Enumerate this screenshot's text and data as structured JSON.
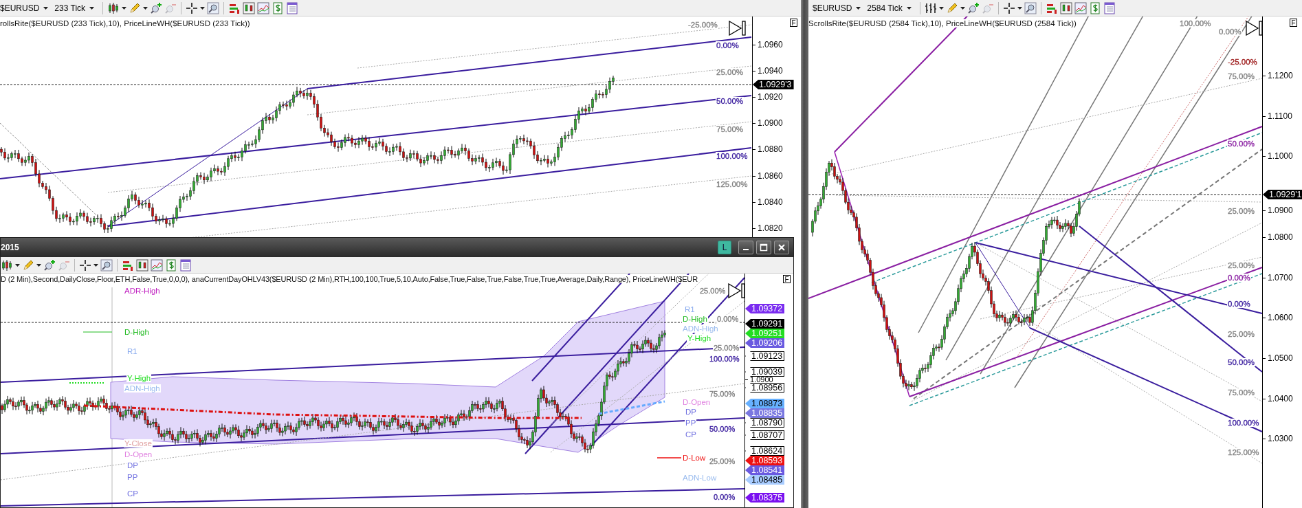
{
  "top_left_chart": {
    "instrument": "$EURUSD",
    "interval": "233 Tick",
    "tools": [
      {
        "disabled": false
      },
      {
        "disabled": false
      },
      {
        "disabled": false
      },
      {
        "disabled": true
      },
      {
        "disabled": false
      },
      {
        "disabled": false
      },
      {
        "disabled": false
      },
      {
        "disabled": false
      },
      {
        "disabled": false
      },
      {
        "disabled": false
      },
      {
        "disabled": false
      }
    ],
    "indicators": "rollsRite($EURUSD (233 Tick),10), PriceLineWH($EURUSD (233 Tick))",
    "panel_button": "F",
    "price_ticks": [
      "1.0960",
      "1.0940",
      "1.0920",
      "1.0900",
      "1.0880",
      "1.0860",
      "1.0840",
      "1.0820"
    ],
    "current_price": "1.0929'3",
    "fib_labels": [
      {
        "text": "-25.00%",
        "color": "#808080"
      },
      {
        "text": "0.00%",
        "color": "#3a1d9e"
      },
      {
        "text": "25.00%",
        "color": "#808080"
      },
      {
        "text": "50.00%",
        "color": "#3a1d9e"
      },
      {
        "text": "75.00%",
        "color": "#808080"
      },
      {
        "text": "100.00%",
        "color": "#3a1d9e"
      },
      {
        "text": "125.00%",
        "color": "#808080"
      }
    ]
  },
  "right_chart": {
    "instrument": "$EURUSD",
    "interval": "2584 Tick",
    "tools": [
      {
        "disabled": false
      },
      {
        "disabled": false
      },
      {
        "disabled": false
      },
      {
        "disabled": true
      },
      {
        "disabled": false
      },
      {
        "disabled": false
      },
      {
        "disabled": false
      },
      {
        "disabled": false
      },
      {
        "disabled": false
      },
      {
        "disabled": false
      },
      {
        "disabled": false
      }
    ],
    "indicators": "ScrollsRite($EURUSD (2584 Tick),10), PriceLineWH($EURUSD (2584 Tick))",
    "panel_button": "F",
    "price_ticks": [
      "1.1200",
      "1.1100",
      "1.1000",
      "1.0900",
      "1.0800",
      "1.0700",
      "1.0600",
      "1.0500",
      "1.0400",
      "1.0300"
    ],
    "current_price": "1.0929'1",
    "fib_labels": [
      {
        "text": "100.00%",
        "color": "#808080"
      },
      {
        "text": "0.00%",
        "color": "#808080"
      },
      {
        "text": "-25.00%",
        "color": "#a02020"
      },
      {
        "text": "75.00%",
        "color": "#808080"
      },
      {
        "text": "50.00%",
        "color": "#8a1fa2"
      },
      {
        "text": "25.00%",
        "color": "#808080"
      },
      {
        "text": "25.00%",
        "color": "#808080"
      },
      {
        "text": "0.00%",
        "color": "#8a1fa2"
      },
      {
        "text": "0.00%",
        "color": "#3a1d9e"
      },
      {
        "text": "25.00%",
        "color": "#808080"
      },
      {
        "text": "50.00%",
        "color": "#3a1d9e"
      },
      {
        "text": "75.00%",
        "color": "#808080"
      },
      {
        "text": "100.00%",
        "color": "#3a1d9e"
      },
      {
        "text": "125.00%",
        "color": "#808080"
      }
    ]
  },
  "bottom_chart": {
    "window_title": "2015",
    "layout_button": "L",
    "tools": [
      {
        "disabled": false
      },
      {
        "disabled": false
      },
      {
        "disabled": false
      },
      {
        "disabled": true
      },
      {
        "disabled": false
      },
      {
        "disabled": false
      },
      {
        "disabled": false
      },
      {
        "disabled": false
      },
      {
        "disabled": false
      },
      {
        "disabled": false
      },
      {
        "disabled": false
      }
    ],
    "indicators": "D (2 Min),Second,DailyClose,Floor,ETH,False,True,0,0,0), anaCurrentDayOHLV43($EURUSD (2 Min),RTH,100,100,True,5,10,Auto,False,True,False,True,False,True,True,Average,Daily,Range), PriceLineWH($EUR",
    "panel_button": "F",
    "price_ticks": [
      "1.0900"
    ],
    "price_tags": [
      {
        "text": "1.09372",
        "color": "#7a2cf0"
      },
      {
        "text": "1.09291",
        "color": "#000000"
      },
      {
        "text": "1.09251",
        "color": "#22dd22"
      },
      {
        "text": "1.09206",
        "color": "#6a5ae0"
      },
      {
        "text": "1.09123",
        "color": "#ffffff"
      },
      {
        "text": "1.09039",
        "color": "#ffffff"
      },
      {
        "text": "1.08956",
        "color": "#ffffff"
      },
      {
        "text": "1.08873",
        "color": "#66b0ff"
      },
      {
        "text": "1.08835",
        "color": "#7a78e0"
      },
      {
        "text": "1.08790",
        "color": "#ffffff"
      },
      {
        "text": "1.08707",
        "color": "#ffffff"
      },
      {
        "text": "1.08624",
        "color": "#ffffff"
      },
      {
        "text": "1.08593",
        "color": "#ee1111"
      },
      {
        "text": "1.08541",
        "color": "#6a5ae0"
      },
      {
        "text": "1.08485",
        "color": "#a8ccff"
      },
      {
        "text": "1.08375",
        "color": "#7a10f0"
      }
    ],
    "level_labels": [
      {
        "text": "ADR-High",
        "color": "#c020c0"
      },
      {
        "text": "D-High",
        "color": "#22bb22"
      },
      {
        "text": "R1",
        "color": "#88aaee"
      },
      {
        "text": "Y-High",
        "color": "#22dd22"
      },
      {
        "text": "ADN-High",
        "color": "#99bbee"
      },
      {
        "text": "Y-Close",
        "color": "#e0a0a0"
      },
      {
        "text": "D-Open",
        "color": "#e080e0"
      },
      {
        "text": "DP",
        "color": "#7070e0"
      },
      {
        "text": "PP",
        "color": "#7070e0"
      },
      {
        "text": "CP",
        "color": "#7070e0"
      },
      {
        "text": "R1",
        "color": "#88aaee"
      },
      {
        "text": "D-High",
        "color": "#22bb22"
      },
      {
        "text": "ADN-High",
        "color": "#99bbee"
      },
      {
        "text": "Y-High",
        "color": "#22dd22"
      },
      {
        "text": "D-Open",
        "color": "#e080e0"
      },
      {
        "text": "DP",
        "color": "#7070e0"
      },
      {
        "text": "PP",
        "color": "#7070e0"
      },
      {
        "text": "CP",
        "color": "#7070e0"
      },
      {
        "text": "D-Low",
        "color": "#ee1111"
      },
      {
        "text": "ADN-Low",
        "color": "#99bbee"
      }
    ],
    "fib_labels": [
      {
        "text": "25.00%",
        "color": "#808080"
      },
      {
        "text": "0.00%",
        "color": "#808080"
      },
      {
        "text": "25.00%",
        "color": "#808080"
      },
      {
        "text": "100.00%",
        "color": "#3a1d9e"
      },
      {
        "text": "75.00%",
        "color": "#808080"
      },
      {
        "text": "50.00%",
        "color": "#3a1d9e"
      },
      {
        "text": "25.00%",
        "color": "#808080"
      },
      {
        "text": "0.00%",
        "color": "#3a1d9e"
      }
    ]
  }
}
